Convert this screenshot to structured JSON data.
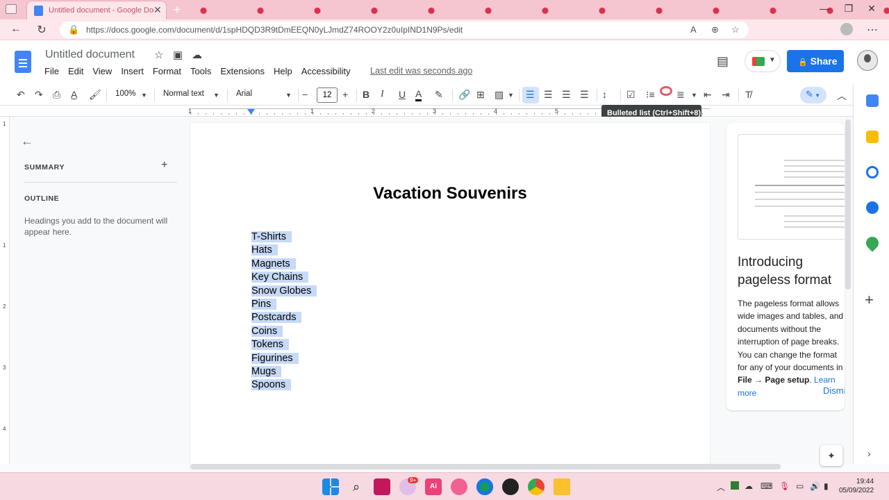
{
  "browser": {
    "tab_title": "Untitled document - Google Docs",
    "url": "https://docs.google.com/document/d/1spHDQD3R9tDmEEQN0yLJmdZ74ROOY2z0uIpIND1N9Ps/edit"
  },
  "docs": {
    "title": "Untitled document",
    "menu": [
      "File",
      "Edit",
      "View",
      "Insert",
      "Format",
      "Tools",
      "Extensions",
      "Help",
      "Accessibility"
    ],
    "last_edit": "Last edit was seconds ago",
    "share_label": "Share"
  },
  "toolbar": {
    "zoom": "100%",
    "style": "Normal text",
    "font": "Arial",
    "font_size": "12",
    "tooltip": "Bulleted list (Ctrl+Shift+8)"
  },
  "ruler": {
    "h_numbers": [
      "1",
      "1",
      "2",
      "3",
      "4",
      "5"
    ],
    "v_numbers": [
      "1",
      "1",
      "2",
      "3",
      "4"
    ]
  },
  "sidebar": {
    "summary_label": "SUMMARY",
    "outline_label": "OUTLINE",
    "outline_hint": "Headings you add to the document will appear here."
  },
  "document": {
    "heading": "Vacation Souvenirs",
    "items": [
      "T-Shirts",
      "Hats",
      "Magnets",
      "Key Chains",
      "Snow Globes",
      "Pins",
      "Postcards",
      "Coins",
      "Tokens",
      "Figurines",
      "Mugs",
      "Spoons"
    ]
  },
  "promo_panel": {
    "title": "Introducing pageless format",
    "body": "The pageless format allows wide images and tables, and documents without the interruption of page breaks. You can change the format for any of your documents in",
    "path": "File → Page setup",
    "link": "Learn more",
    "dismiss": "Dismiss"
  },
  "taskbar": {
    "time": "19:44",
    "date": "05/09/2022",
    "badge": "9+"
  },
  "colors": {
    "accent": "#1a73e8",
    "selection": "#c6d9f7",
    "tab_strip": "#f6c6d0"
  }
}
